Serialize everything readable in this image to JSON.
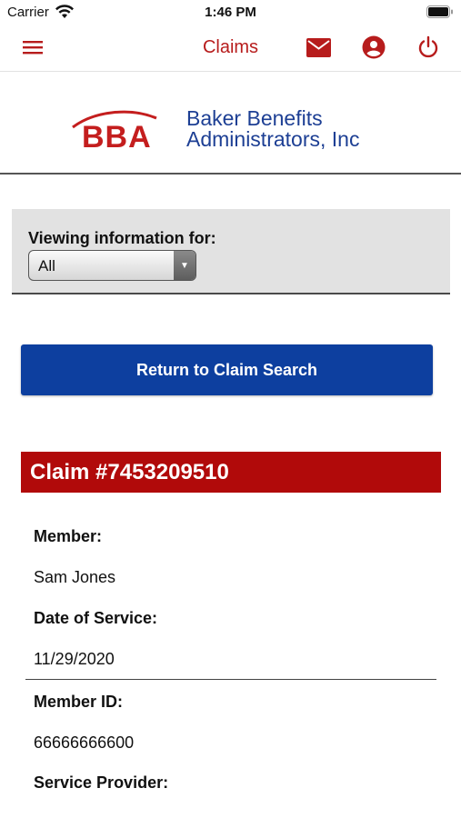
{
  "status_bar": {
    "carrier": "Carrier",
    "time": "1:46 PM"
  },
  "nav": {
    "title": "Claims",
    "accent_color": "#b71c1c",
    "icons": [
      "menu-icon",
      "mail-icon",
      "account-icon",
      "power-icon"
    ]
  },
  "logo": {
    "mark": "BBA",
    "line1": "Baker Benefits",
    "line2": "Administrators, Inc",
    "brand_red": "#c41e1e",
    "brand_blue": "#1d3f94"
  },
  "viewing": {
    "label": "Viewing information for:",
    "selected": "All"
  },
  "actions": {
    "return_label": "Return to Claim Search",
    "button_color": "#0d3f9f"
  },
  "claim": {
    "header": "Claim #7453209510",
    "header_color": "#b10a0a",
    "fields": [
      {
        "label": "Member:",
        "value": "Sam Jones"
      },
      {
        "label": "Date of Service:",
        "value": "11/29/2020"
      },
      {
        "label": "Member ID:",
        "value": "66666666600"
      },
      {
        "label": "Service Provider:",
        "value": ""
      }
    ]
  }
}
